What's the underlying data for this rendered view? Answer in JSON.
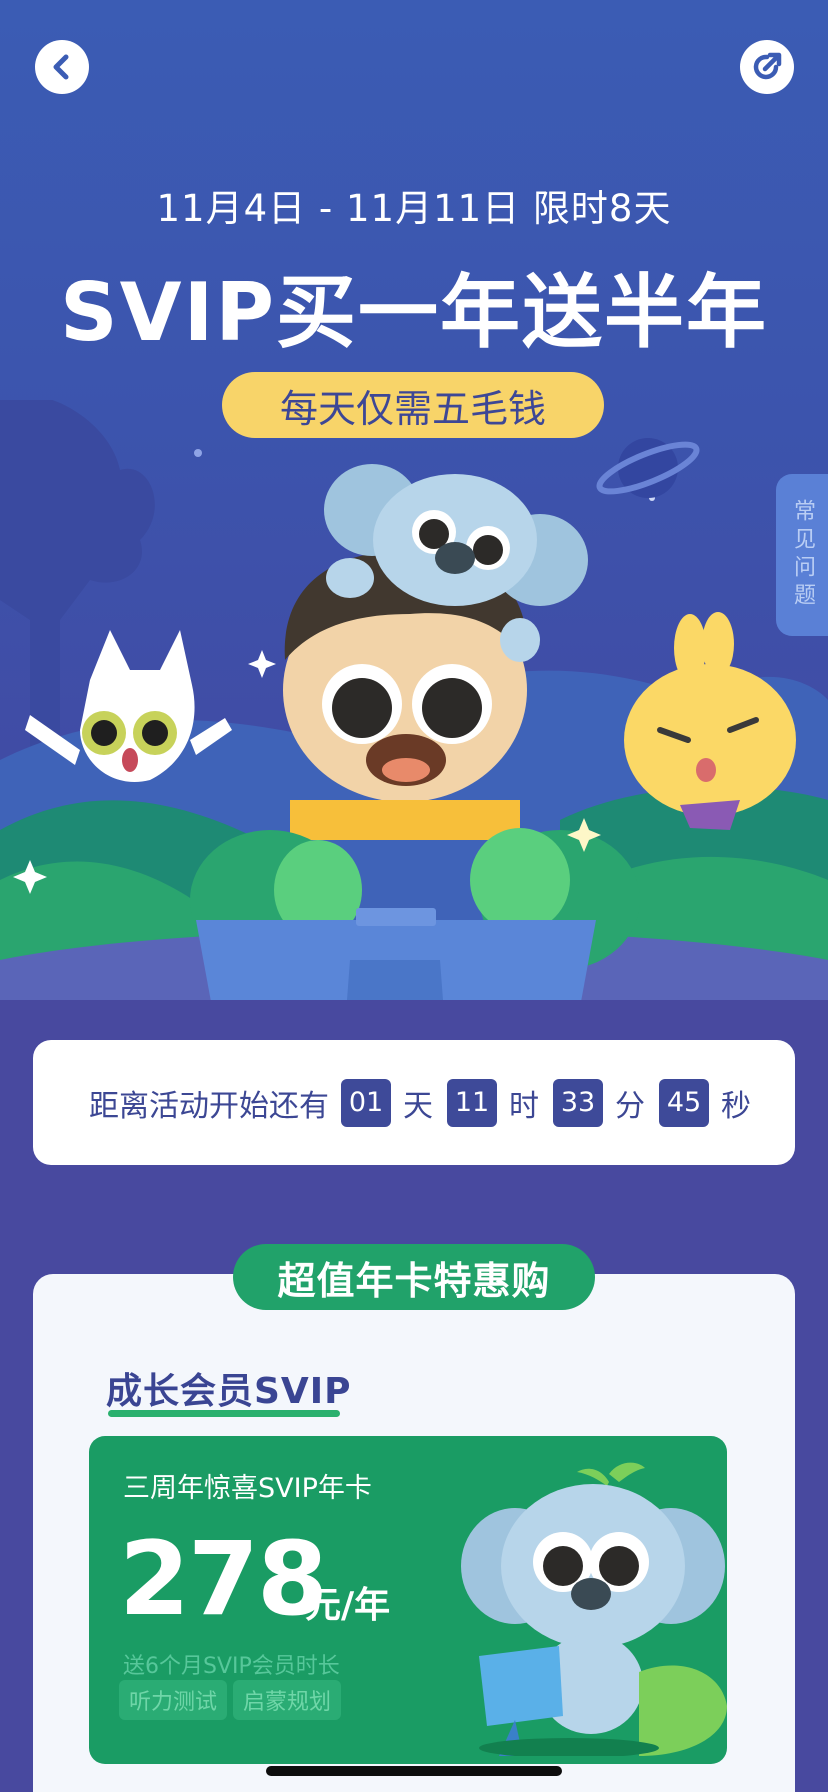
{
  "header": {
    "back_icon": "chevron-left-icon",
    "share_icon": "share-icon",
    "date_range": "11月4日 - 11月11日 限时8天",
    "headline": "SVIP买一年送半年",
    "subline": "每天仅需五毛钱",
    "faq_label": "常见问题"
  },
  "countdown": {
    "prefix": "距离活动开始还有",
    "days": "01",
    "days_unit": "天",
    "hours": "11",
    "hours_unit": "时",
    "minutes": "33",
    "minutes_unit": "分",
    "seconds": "45",
    "seconds_unit": "秒"
  },
  "offer": {
    "section_title": "超值年卡特惠购",
    "tier_title": "成长会员SVIP",
    "product_name": "三周年惊喜SVIP年卡",
    "price": "278",
    "price_unit": "元/年",
    "bonus": "送6个月SVIP会员时长",
    "tags": [
      "听力测试",
      "启蒙规划"
    ]
  },
  "colors": {
    "hero_bg": "#3b5cb4",
    "accent_green": "#21a26a",
    "pill_yellow": "#f8d469",
    "countdown_box": "#3e4a99"
  }
}
